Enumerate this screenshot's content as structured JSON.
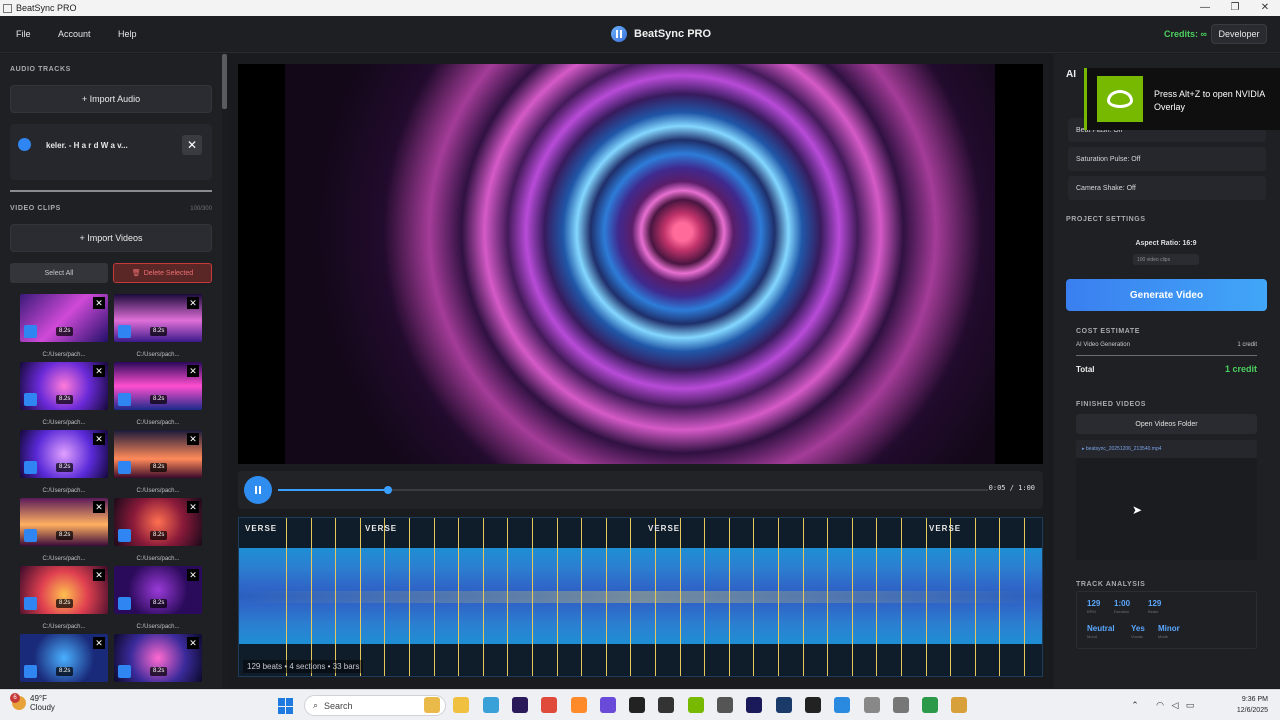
{
  "window": {
    "title": "BeatSync PRO",
    "controls": [
      "—",
      "❐",
      "✕"
    ]
  },
  "menu": {
    "items": [
      "File",
      "Account",
      "Help"
    ],
    "brand": "BeatSync PRO",
    "credits": "Credits: ∞",
    "developer": "Developer"
  },
  "left": {
    "audio_label": "AUDIO TRACKS",
    "import_audio": "+ Import Audio",
    "track_name": "keler. - H a r d W a v...",
    "video_label": "VIDEO CLIPS",
    "clip_count": "100/300",
    "import_videos": "+ Import Videos",
    "select_all": "Select All",
    "delete_selected": "Delete Selected",
    "clip_duration": "8.2s",
    "clip_path": "C:/Users/pach..."
  },
  "player": {
    "time": "0:05 / 1:00",
    "progress": 0.155
  },
  "waveform": {
    "sections": [
      "VERSE",
      "VERSE",
      "VERSE",
      "VERSE"
    ],
    "info": "129 beats • 4 sections • 33 bars"
  },
  "right": {
    "ai_title": "AI",
    "effects": [
      "Beat Flash: Off",
      "Saturation Pulse: Off",
      "Camera Shake: Off"
    ],
    "project_label": "PROJECT SETTINGS",
    "aspect": "Aspect Ratio: 16:9",
    "clips_pill": "100 video clips",
    "generate": "Generate Video",
    "cost_label": "COST ESTIMATE",
    "cost_item": "AI Video Generation",
    "cost_item_val": "1 credit",
    "total_label": "Total",
    "total_val": "1 credit",
    "finished_label": "FINISHED VIDEOS",
    "open_folder": "Open Videos Folder",
    "video_file": "▸ beatsync_20251206_213540.mp4",
    "analysis_label": "TRACK ANALYSIS",
    "stats": [
      {
        "v": "129",
        "k": "BPM"
      },
      {
        "v": "1:00",
        "k": "Duration"
      },
      {
        "v": "129",
        "k": "Beats"
      },
      {
        "v": "Neutral",
        "k": "Mood"
      },
      {
        "v": "Yes",
        "k": "Vocals"
      },
      {
        "v": "Minor",
        "k": "Mode"
      }
    ]
  },
  "nvidia": {
    "text": "Press Alt+Z to open NVIDIA Overlay"
  },
  "taskbar": {
    "temp": "49°F",
    "weather": "Cloudy",
    "badge": "6",
    "search": "Search",
    "time": "9:36 PM",
    "date": "12/6/2025"
  },
  "colors": {
    "accent": "#2f86f2",
    "credit_green": "#4bd05f",
    "danger": "#c23a3a",
    "beat_line": "#e6c85a",
    "nvidia": "#76b900"
  }
}
